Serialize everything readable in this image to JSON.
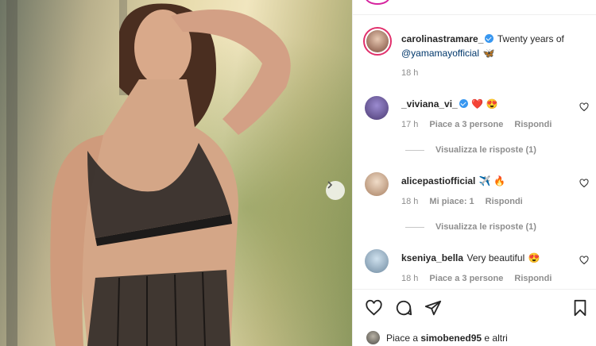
{
  "post": {
    "owner": "carolinastramare_",
    "caption_text": "Twenty years of",
    "caption_mention": "@yamamayofficial",
    "caption_emoji": "🦋",
    "time": "18 h"
  },
  "comments": [
    {
      "user": "_viviana_vi_",
      "verified": true,
      "text": "",
      "emojis": "❤️ 😍",
      "time": "17 h",
      "likes": "Piace a 3 persone",
      "reply": "Rispondi",
      "view_replies": "Visualizza le risposte (1)"
    },
    {
      "user": "alicepastiofficial",
      "verified": false,
      "text": "",
      "emojis": "✈️ 🔥",
      "time": "18 h",
      "likes": "Mi piace: 1",
      "reply": "Rispondi",
      "view_replies": "Visualizza le risposte (1)"
    },
    {
      "user": "kseniya_bella",
      "verified": false,
      "text": "Very beautiful",
      "emojis": "😍",
      "time": "18 h",
      "likes": "Piace a 3 persone",
      "reply": "Rispondi"
    }
  ],
  "likes_bar": {
    "prefix": "Piace a",
    "user": "simobened95",
    "suffix": "e altri"
  },
  "icons": [
    "chevron-right-icon",
    "heart-icon",
    "comment-icon",
    "share-icon",
    "bookmark-icon"
  ],
  "colors": {
    "verified": "#3897f0",
    "mention": "#00376b",
    "meta": "#8e8e8e"
  }
}
